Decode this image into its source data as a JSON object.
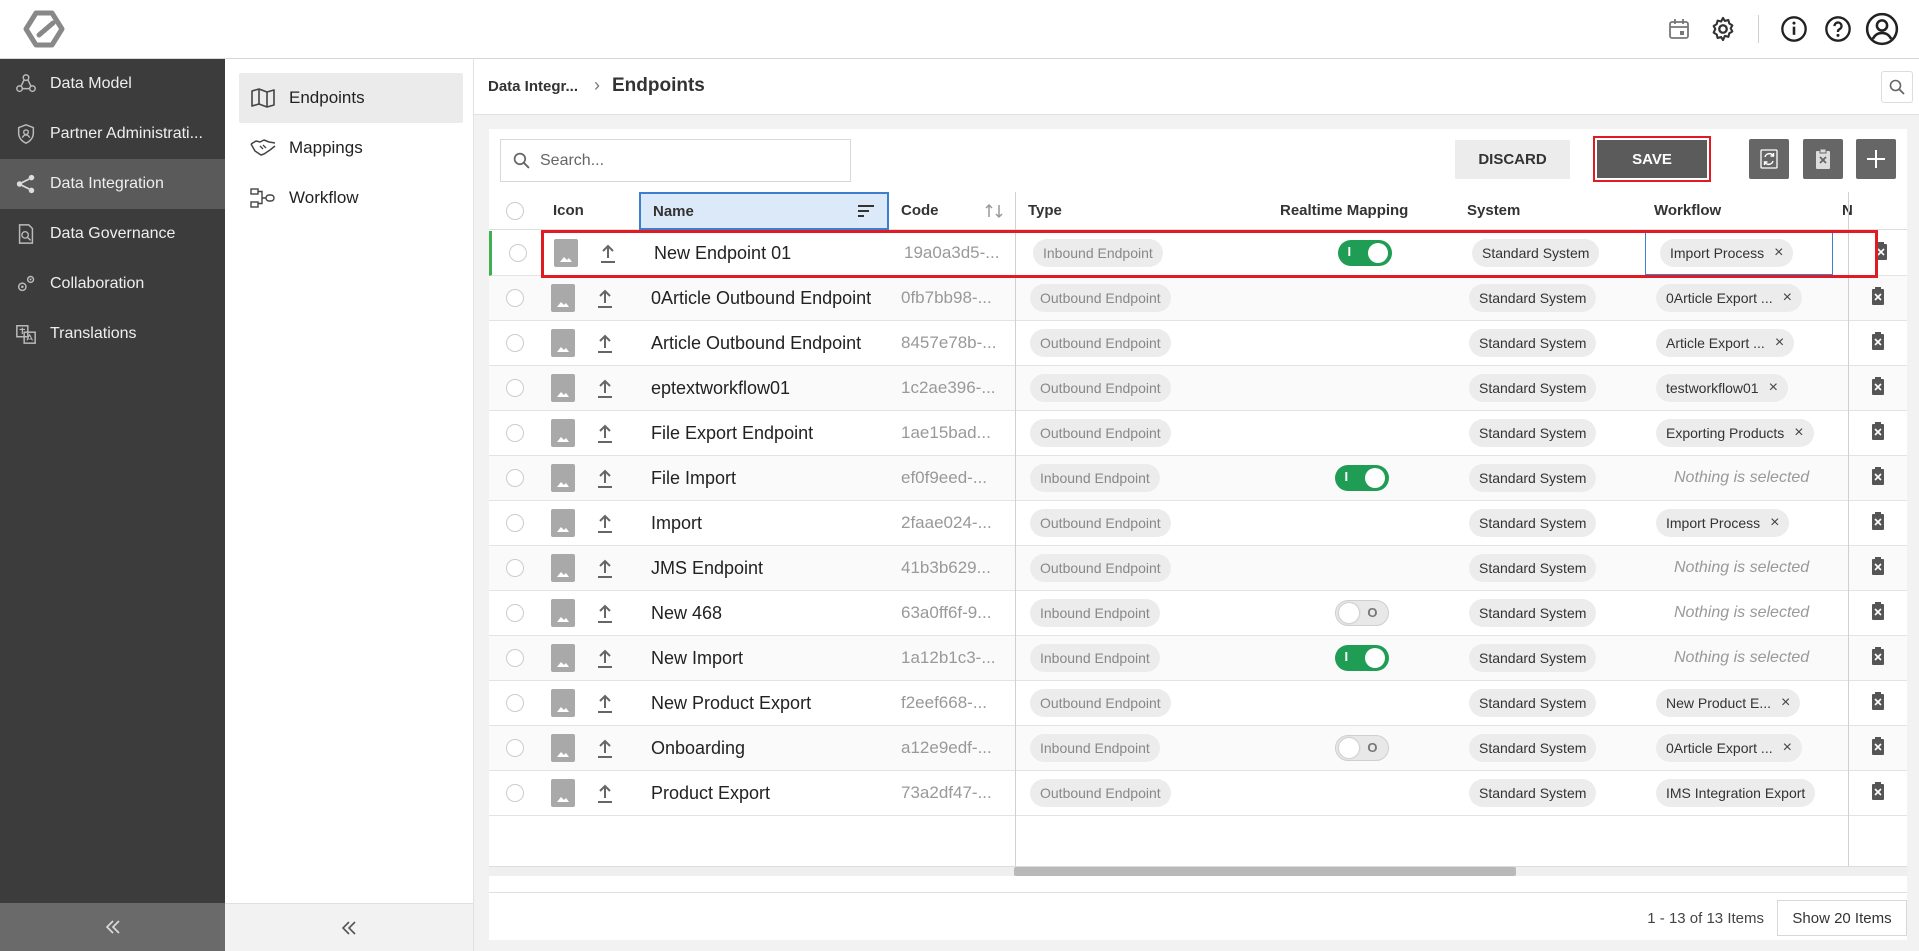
{
  "topbar": {
    "icons": [
      "logo-icon",
      "calendar-icon",
      "gear-icon",
      "info-icon",
      "help-icon",
      "user-icon"
    ]
  },
  "sidebar": {
    "items": [
      {
        "label": "Data Model",
        "icon": "data-model-icon"
      },
      {
        "label": "Partner Administrati...",
        "icon": "shield-icon"
      },
      {
        "label": "Data Integration",
        "icon": "share-icon",
        "active": true
      },
      {
        "label": "Data Governance",
        "icon": "document-check-icon"
      },
      {
        "label": "Collaboration",
        "icon": "gears-icon"
      },
      {
        "label": "Translations",
        "icon": "translate-icon"
      }
    ]
  },
  "subnav": {
    "items": [
      {
        "label": "Endpoints",
        "icon": "map-icon",
        "active": true
      },
      {
        "label": "Mappings",
        "icon": "handshake-icon"
      },
      {
        "label": "Workflow",
        "icon": "workflow-icon"
      }
    ]
  },
  "breadcrumb": {
    "parent": "Data Integr...",
    "separator": "›",
    "current": "Endpoints"
  },
  "toolbar": {
    "search_placeholder": "Search...",
    "discard_label": "DISCARD",
    "save_label": "SAVE"
  },
  "table": {
    "columns": [
      "Icon",
      "Name",
      "Code",
      "Type",
      "Realtime Mapping",
      "System",
      "Workflow",
      "N"
    ],
    "rows": [
      {
        "name": "New Endpoint 01",
        "code": "19a0a3d5-...",
        "type": "Inbound Endpoint",
        "realtime": "on",
        "system": "Standard System",
        "workflow": "Import Process",
        "removable": true
      },
      {
        "name": "0Article Outbound Endpoint",
        "code": "0fb7bb98-...",
        "type": "Outbound Endpoint",
        "realtime": "none",
        "system": "Standard System",
        "workflow": "0Article Export ...",
        "removable": true
      },
      {
        "name": "Article Outbound Endpoint",
        "code": "8457e78b-...",
        "type": "Outbound Endpoint",
        "realtime": "none",
        "system": "Standard System",
        "workflow": "Article Export ...",
        "removable": true
      },
      {
        "name": "eptextworkflow01",
        "code": "1c2ae396-...",
        "type": "Outbound Endpoint",
        "realtime": "none",
        "system": "Standard System",
        "workflow": "testworkflow01",
        "removable": true
      },
      {
        "name": "File Export Endpoint",
        "code": "1ae15bad...",
        "type": "Outbound Endpoint",
        "realtime": "none",
        "system": "Standard System",
        "workflow": "Exporting Products",
        "removable": true
      },
      {
        "name": "File Import",
        "code": "ef0f9eed-...",
        "type": "Inbound Endpoint",
        "realtime": "on",
        "system": "Standard System",
        "workflow": "",
        "removable": false
      },
      {
        "name": "Import",
        "code": "2faae024-...",
        "type": "Outbound Endpoint",
        "realtime": "none",
        "system": "Standard System",
        "workflow": "Import Process",
        "removable": true
      },
      {
        "name": "JMS Endpoint",
        "code": "41b3b629...",
        "type": "Outbound Endpoint",
        "realtime": "none",
        "system": "Standard System",
        "workflow": "",
        "removable": false
      },
      {
        "name": "New 468",
        "code": "63a0ff6f-9...",
        "type": "Inbound Endpoint",
        "realtime": "off",
        "system": "Standard System",
        "workflow": "",
        "removable": false
      },
      {
        "name": "New Import",
        "code": "1a12b1c3-...",
        "type": "Inbound Endpoint",
        "realtime": "on",
        "system": "Standard System",
        "workflow": "",
        "removable": false
      },
      {
        "name": "New Product Export",
        "code": "f2eef668-...",
        "type": "Outbound Endpoint",
        "realtime": "none",
        "system": "Standard System",
        "workflow": "New Product E...",
        "removable": true
      },
      {
        "name": "Onboarding",
        "code": "a12e9edf-...",
        "type": "Inbound Endpoint",
        "realtime": "off",
        "system": "Standard System",
        "workflow": "0Article Export ...",
        "removable": true
      },
      {
        "name": "Product Export",
        "code": "73a2df47-...",
        "type": "Outbound Endpoint",
        "realtime": "none",
        "system": "Standard System",
        "workflow": "IMS Integration Export",
        "removable": false
      }
    ],
    "empty_workflow": "Nothing is selected",
    "toggle_on_label": "I",
    "toggle_off_label": "O"
  },
  "footer": {
    "count": "1 - 13 of 13 Items",
    "page_size": "Show 20 Items"
  },
  "colors": {
    "sidebar_bg": "#3c3c3c",
    "toggle_on": "#1f9d55",
    "highlight": "#e01b24",
    "selected_header": "#3d7fcf"
  }
}
